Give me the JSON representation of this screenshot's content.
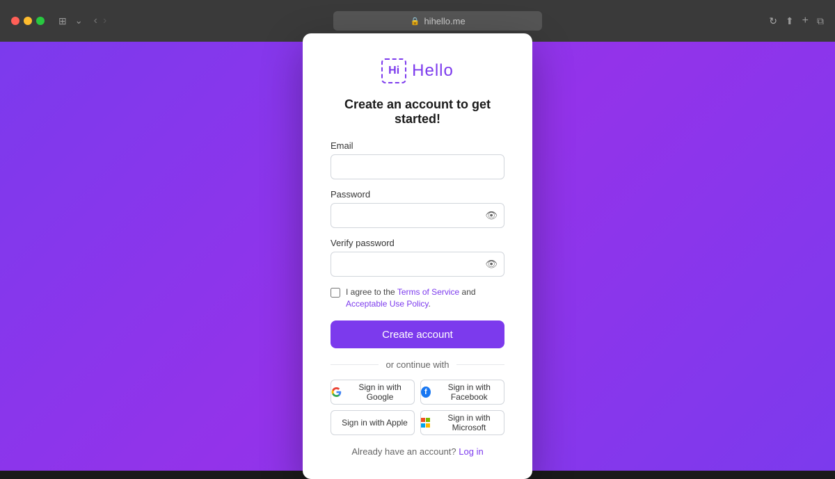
{
  "browser": {
    "url": "hihello.me",
    "traffic_lights": [
      "red",
      "yellow",
      "green"
    ]
  },
  "logo": {
    "hi_text": "Hi",
    "hello_text": "Hello"
  },
  "card": {
    "title": "Create an account to get started!",
    "email_label": "Email",
    "email_placeholder": "",
    "password_label": "Password",
    "password_placeholder": "",
    "verify_password_label": "Verify password",
    "verify_password_placeholder": "",
    "terms_text_before": "I agree to the ",
    "terms_link": "Terms of Service",
    "terms_and": " and ",
    "acceptable_link": "Acceptable Use Policy",
    "terms_text_after": ".",
    "create_button_label": "Create account",
    "divider_text": "or continue with",
    "social_buttons": [
      {
        "id": "google",
        "label": "Sign in with Google"
      },
      {
        "id": "facebook",
        "label": "Sign in with Facebook"
      },
      {
        "id": "apple",
        "label": "Sign in with Apple"
      },
      {
        "id": "microsoft",
        "label": "Sign in with Microsoft"
      }
    ],
    "footer_text": "Already have an account?",
    "footer_link": "Log in"
  }
}
